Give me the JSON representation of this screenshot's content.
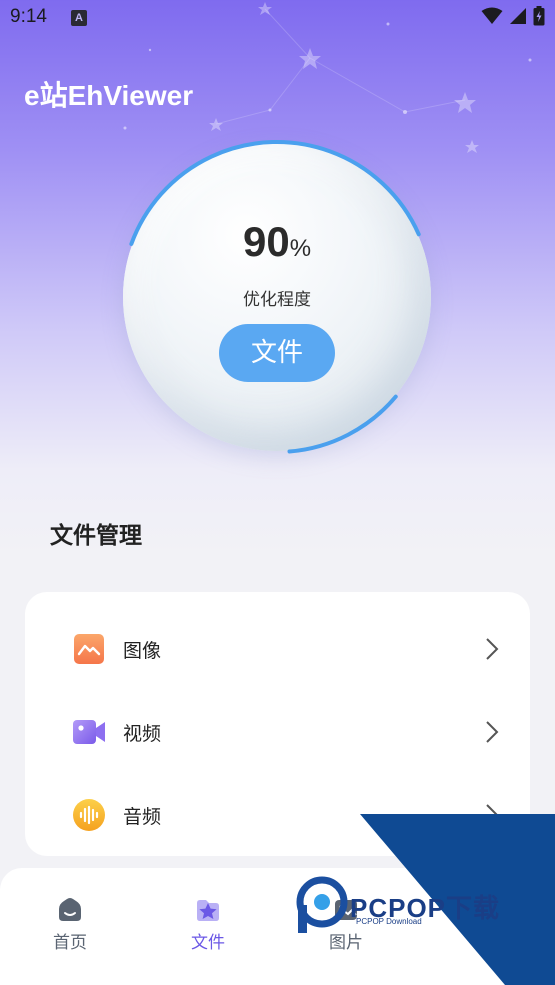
{
  "status_bar": {
    "time": "9:14",
    "notification_icon": "a-letter-icon",
    "icons": [
      "wifi-icon",
      "signal-icon",
      "battery-icon"
    ]
  },
  "app": {
    "title": "e站EhViewer"
  },
  "optimizer": {
    "value": "90",
    "unit": "%",
    "progress": 0.9,
    "label": "优化程度",
    "button_label": "文件"
  },
  "file_management": {
    "title": "文件管理",
    "items": [
      {
        "label": "图像",
        "icon": "image-icon",
        "color": "#f98a54"
      },
      {
        "label": "视频",
        "icon": "video-icon",
        "color": "#8b6cf0"
      },
      {
        "label": "音频",
        "icon": "audio-icon",
        "color": "#f6b42b"
      }
    ]
  },
  "bottom_nav": {
    "items": [
      {
        "label": "首页",
        "icon": "home-icon",
        "active": false
      },
      {
        "label": "文件",
        "icon": "file-star-icon",
        "active": true
      },
      {
        "label": "图片",
        "icon": "picture-icon",
        "active": false
      }
    ]
  },
  "colors": {
    "accent": "#5aa8f2",
    "nav_active": "#6b58e6",
    "nav_inactive": "#5a6472",
    "header_gradient_top": "#7f6bef"
  },
  "watermark": {
    "text": "PCPOP下载",
    "subtext": "PCPOP Download"
  }
}
